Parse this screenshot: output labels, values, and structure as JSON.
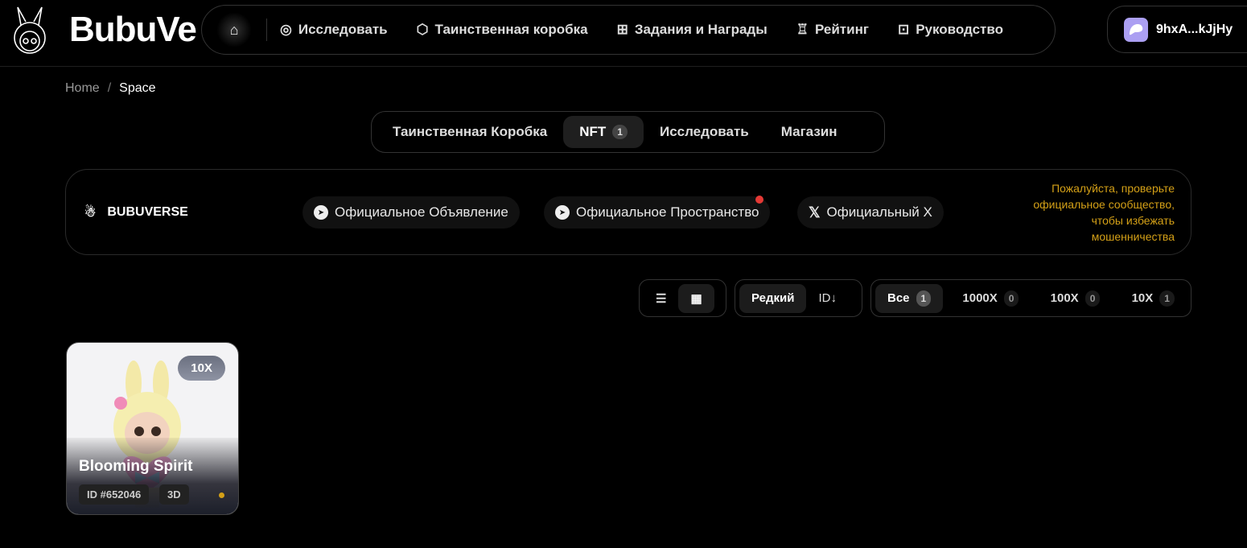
{
  "header": {
    "brand": "BubuVe",
    "nav": [
      {
        "label": "Исследовать",
        "icon": "compass-icon"
      },
      {
        "label": "Таинственная коробка",
        "icon": "box-icon"
      },
      {
        "label": "Задания и Награды",
        "icon": "gift-icon"
      },
      {
        "label": "Рейтинг",
        "icon": "trophy-icon"
      },
      {
        "label": "Руководство",
        "icon": "book-icon"
      }
    ],
    "wallet": "9hxA...kJjHy"
  },
  "breadcrumb": {
    "home": "Home",
    "sep": "/",
    "current": "Space"
  },
  "tabs": [
    {
      "label": "Таинственная Коробка"
    },
    {
      "label": "NFT",
      "badge": "1"
    },
    {
      "label": "Исследовать"
    },
    {
      "label": "Магазин"
    }
  ],
  "community": {
    "name": "BUBUVERSE",
    "links": [
      "Официальное Объявление",
      "Официальное Пространство",
      "Официальный X"
    ],
    "warning": [
      "Пожалуйста, проверьте",
      "официальное сообщество,",
      "чтобы избежать",
      "мошенничества"
    ]
  },
  "filters": {
    "sort": "Редкий",
    "id_sort": "ID↓",
    "rarity": [
      {
        "label": "Все",
        "count": "1"
      },
      {
        "label": "1000X",
        "count": "0"
      },
      {
        "label": "100X",
        "count": "0"
      },
      {
        "label": "10X",
        "count": "1"
      }
    ]
  },
  "cards": [
    {
      "name": "Blooming Spirit",
      "multiplier": "10X",
      "id": "ID #652046",
      "type": "3D"
    }
  ],
  "colors": {
    "accent": "#d4a017",
    "wallet_icon": "#ab9ff2"
  }
}
